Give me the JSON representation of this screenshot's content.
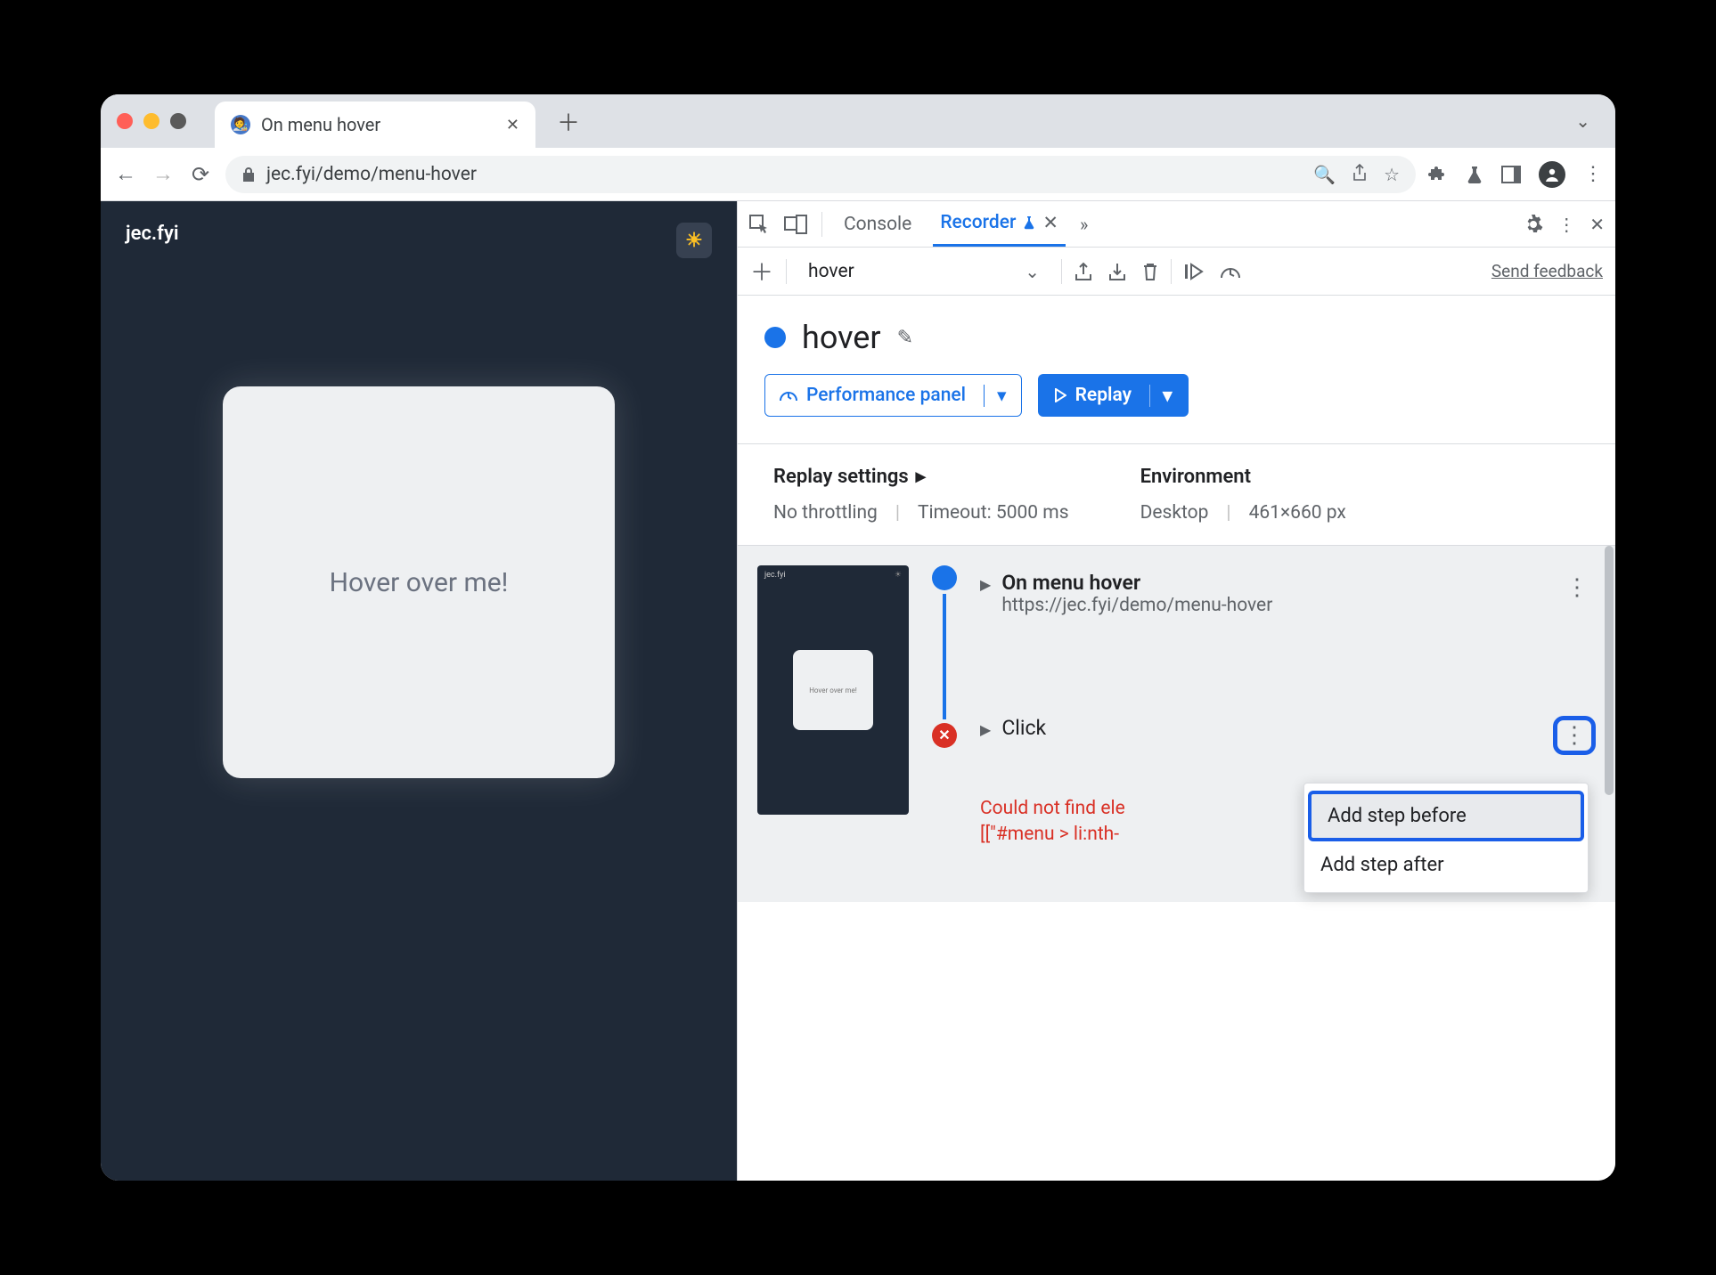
{
  "browser": {
    "tab_title": "On menu hover",
    "url": "jec.fyi/demo/menu-hover"
  },
  "page": {
    "site_name": "jec.fyi",
    "card_text": "Hover over me!"
  },
  "devtools": {
    "tabs": {
      "console": "Console",
      "recorder": "Recorder"
    }
  },
  "recorder": {
    "name": "hover",
    "feedback": "Send feedback",
    "perf_panel": "Performance panel",
    "replay": "Replay",
    "settings": {
      "replay_heading": "Replay settings",
      "throttling": "No throttling",
      "timeout": "Timeout: 5000 ms",
      "env_heading": "Environment",
      "device": "Desktop",
      "viewport": "461×660 px"
    },
    "steps": {
      "nav_title": "On menu hover",
      "nav_url": "https://jec.fyi/demo/menu-hover",
      "click_title": "Click",
      "error_l1": "Could not find ele",
      "error_l2": "[[\"#menu > li:nth-"
    },
    "menu": {
      "before": "Add step before",
      "after": "Add step after"
    },
    "thumb_text": "Hover over me!"
  }
}
